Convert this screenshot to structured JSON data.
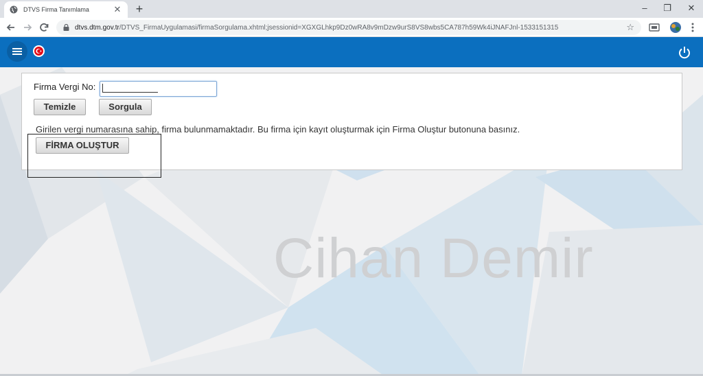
{
  "browser": {
    "tab_title": "DTVS Firma Tanımlama",
    "tab_close": "✕",
    "new_tab": "+",
    "url_host": "dtvs.dtm.gov.tr",
    "url_path": "/DTVS_FirmaUygulamasi/firmaSorgulama.xhtml;jsessionid=XGXGLhkp9Dz0wRA8v9mDzw9urS8VS8wbs5CA787h59Wk4iJNAFJnl-1533151315",
    "window_minimize": "–",
    "window_restore": "❐",
    "window_close": "✕"
  },
  "form": {
    "vkn_label": "Firma Vergi No:",
    "vkn_value": "",
    "clear_button": "Temizle",
    "query_button": "Sorgula",
    "message": "Girilen vergi numarasına sahip, firma bulunmamaktadır. Bu firma için kayıt oluşturmak için Firma Oluştur butonuna basınız.",
    "create_button": "FİRMA OLUŞTUR"
  },
  "watermark": "Cihan Demir",
  "colors": {
    "header_blue": "#0b6fbf",
    "flag_red": "#e30a17"
  }
}
